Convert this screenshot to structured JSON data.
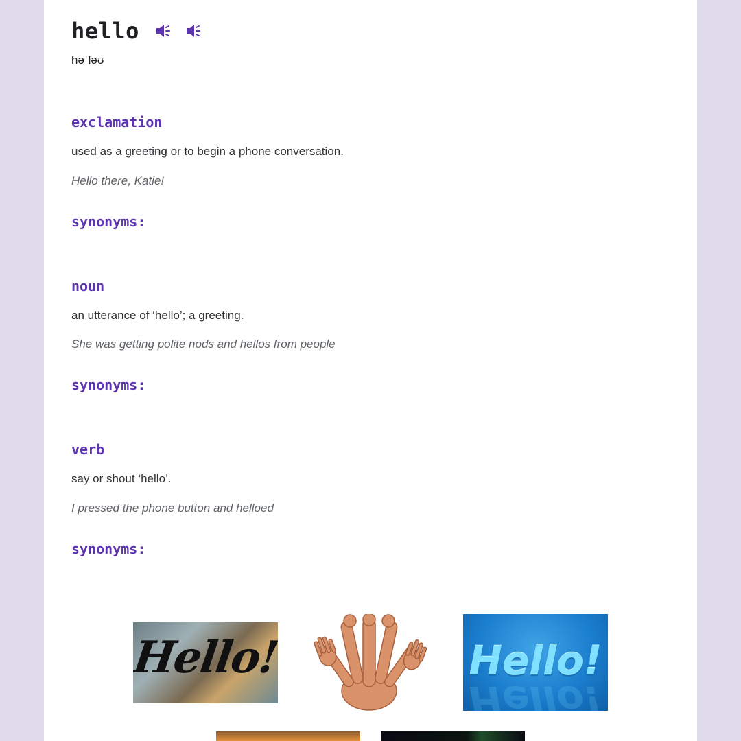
{
  "entry": {
    "word": "hello",
    "phonetic": "həˈləʊ",
    "speaker_icons": [
      "speaker-icon",
      "speaker-icon"
    ]
  },
  "senses": [
    {
      "part_of_speech": "exclamation",
      "definition": "used as a greeting or to begin a phone conversation.",
      "example": "Hello there, Katie!",
      "synonyms_label": "synonyms:"
    },
    {
      "part_of_speech": "noun",
      "definition": "an utterance of ‘hello’; a greeting.",
      "example": "She was getting polite nods and hellos from people",
      "synonyms_label": "synonyms:"
    },
    {
      "part_of_speech": "verb",
      "definition": "say or shout ‘hello’.",
      "example": "I pressed the phone button and helloed",
      "synonyms_label": "synonyms:"
    }
  ],
  "images": [
    {
      "name": "hello-rain-glass-image",
      "text": "Hello!"
    },
    {
      "name": "waving-hands-image",
      "text": ""
    },
    {
      "name": "hello-blue-3d-image",
      "text": "Hello!"
    },
    {
      "name": "sunset-image",
      "text": ""
    },
    {
      "name": "dark-plant-image",
      "text": ""
    }
  ],
  "colors": {
    "accent": "#5e35b1",
    "background": "#dfdbea",
    "card": "#ffffff"
  }
}
